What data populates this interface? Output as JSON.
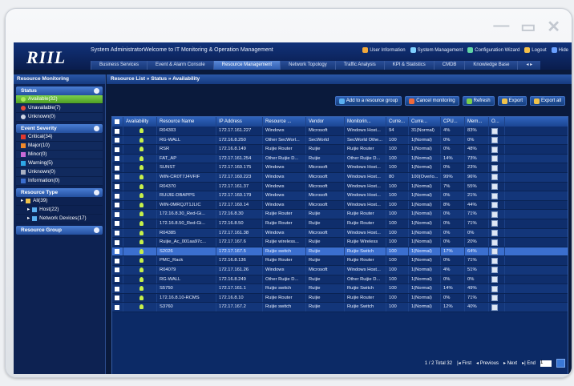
{
  "window_controls": {
    "minimize": "—",
    "maximize": "▭",
    "close": "✕"
  },
  "app": {
    "logo": "RIIL",
    "welcome": "System AdministratorWelcome to IT Monitoring & Operation Management",
    "top_links": [
      "User Information",
      "System Management",
      "Configuration Wizard",
      "Logout",
      "Hide"
    ],
    "top_link_colors": [
      "#f2a93b",
      "#7fd0ff",
      "#62d6a5",
      "#f5c04a",
      "#6aa0ff"
    ],
    "nav_tabs": [
      "Business Services",
      "Event & Alarm Console",
      "Resource Management",
      "Network Topology",
      "Traffic Analysis",
      "KPI & Statistics",
      "CMDB",
      "Knowledge Base",
      "◂ ▸"
    ],
    "active_tab": "Resource Management"
  },
  "sidebar": {
    "title": "Resource Monitoring",
    "status": {
      "label": "Status",
      "items": [
        {
          "label": "Available(32)",
          "selected": true,
          "icon_color": "#a8e85a"
        },
        {
          "label": "Unavailable(7)",
          "icon_color": "#e84a3a"
        },
        {
          "label": "Unknown(0)",
          "icon_color": "#cfd6e4"
        }
      ]
    },
    "severity": {
      "label": "Event Severity",
      "items": [
        {
          "label": "Critical(34)",
          "color": "#e0392f"
        },
        {
          "label": "Major(10)",
          "color": "#f08a2a"
        },
        {
          "label": "Minor(0)",
          "color": "#c86ad6"
        },
        {
          "label": "Warning(5)",
          "color": "#2fa8e6"
        },
        {
          "label": "Unknown(0)",
          "color": "#a9b1c2"
        },
        {
          "label": "Information(0)",
          "color": "#3b6fcf"
        }
      ]
    },
    "resource_type": {
      "label": "Resource Type",
      "items": [
        "All(39)",
        "Host(22)",
        "Network Devices(17)"
      ]
    },
    "resource_group": {
      "label": "Resource Group"
    }
  },
  "main": {
    "breadcrumb": "Resource List  »  Status  »  Availability",
    "toolbar": [
      "Add to a resource group",
      "Cancel monitoring",
      "Refresh",
      "Export",
      "Export all"
    ],
    "columns": [
      "Availability",
      "Resource Name",
      "IP Address",
      "Resource ...",
      "Vendor",
      "Monitorin...",
      "Curre...",
      "Curre...",
      "CPU...",
      "Mem...",
      "O..."
    ],
    "rows": [
      [
        "R04303",
        "172.17.161.227",
        "Windows",
        "Microsoft",
        "Windows Host...",
        "94",
        "31(Normal)",
        "4%",
        "83%"
      ],
      [
        "RG-WALL",
        "172.16.8.250",
        "Other SecWorl...",
        "SecWorld",
        "SecWorld Othe...",
        "100",
        "1(Normal)",
        "0%",
        "0%"
      ],
      [
        "RSR",
        "172.16.8.149",
        "Ruijie Router",
        "Ruijie",
        "Ruijie Router",
        "100",
        "1(Normal)",
        "0%",
        "48%"
      ],
      [
        "FAT_AP",
        "172.17.161.254",
        "Other Ruijie D...",
        "Ruijie",
        "Other Ruijie D...",
        "100",
        "1(Normal)",
        "14%",
        "73%"
      ],
      [
        "SUNST",
        "172.17.160.175",
        "Windows",
        "Microsoft",
        "Windows Host...",
        "100",
        "1(Normal)",
        "0%",
        "23%"
      ],
      [
        "WIN-CR0T7J4VFIF",
        "172.17.160.223",
        "Windows",
        "Microsoft",
        "Windows Host...",
        "80",
        "100(Overlo...",
        "99%",
        "96%"
      ],
      [
        "R04370",
        "172.17.161.37",
        "Windows",
        "Microsoft",
        "Windows Host...",
        "100",
        "1(Normal)",
        "7%",
        "55%"
      ],
      [
        "RUIJIE-DBAPPS",
        "172.17.160.179",
        "Windows",
        "Microsoft",
        "Windows Host...",
        "100",
        "1(Normal)",
        "0%",
        "21%"
      ],
      [
        "WIN-0MRQJT1JLIC",
        "172.17.160.14",
        "Windows",
        "Microsoft",
        "Windows Host...",
        "100",
        "1(Normal)",
        "8%",
        "44%"
      ],
      [
        "172.16.8.30_Red-Gi...",
        "172.16.8.30",
        "Ruijie Router",
        "Ruijie",
        "Ruijie Router",
        "100",
        "1(Normal)",
        "0%",
        "71%"
      ],
      [
        "172.16.8.50_Red-Gi...",
        "172.16.8.50",
        "Ruijie Router",
        "Ruijie",
        "Ruijie Router",
        "100",
        "1(Normal)",
        "0%",
        "71%"
      ],
      [
        "R04385",
        "172.17.161.38",
        "Windows",
        "Microsoft",
        "Windows Host...",
        "100",
        "1(Normal)",
        "0%",
        "0%"
      ],
      [
        "Ruijie_Ac_001aa97c...",
        "172.17.167.6",
        "Ruijie wireless...",
        "Ruijie",
        "Ruijie Wireless",
        "100",
        "1(Normal)",
        "0%",
        "20%"
      ],
      [
        "S2026",
        "172.17.167.5",
        "Ruijie switch",
        "Ruijie",
        "Ruijie Switch",
        "100",
        "1(Normal)",
        "17%",
        "64%"
      ],
      [
        "PMC_Rack",
        "172.16.8.136",
        "Ruijie Router",
        "Ruijie",
        "Ruijie Router",
        "100",
        "1(Normal)",
        "0%",
        "71%"
      ],
      [
        "R04079",
        "172.17.161.26",
        "Windows",
        "Microsoft",
        "Windows Host...",
        "100",
        "1(Normal)",
        "4%",
        "51%"
      ],
      [
        "RG-WALL",
        "172.16.8.249",
        "Other Ruijie D...",
        "Ruijie",
        "Other Ruijie D...",
        "100",
        "1(Normal)",
        "0%",
        "0%"
      ],
      [
        "S5750",
        "172.17.161.1",
        "Ruijie switch",
        "Ruijie",
        "Ruijie Switch",
        "100",
        "1(Normal)",
        "14%",
        "49%"
      ],
      [
        "172.16.8.10-RCMS",
        "172.16.8.10",
        "Ruijie Router",
        "Ruijie",
        "Ruijie Router",
        "100",
        "1(Normal)",
        "0%",
        "71%"
      ],
      [
        "S3760",
        "172.17.167.2",
        "Ruijie switch",
        "Ruijie",
        "Ruijie Switch",
        "100",
        "1(Normal)",
        "12%",
        "40%"
      ]
    ],
    "selected_row": 13,
    "pager": {
      "info": "1 / 2 Total 32",
      "first": "First",
      "previous": "Previous",
      "next": "Next",
      "end": "End",
      "page": "1"
    }
  }
}
